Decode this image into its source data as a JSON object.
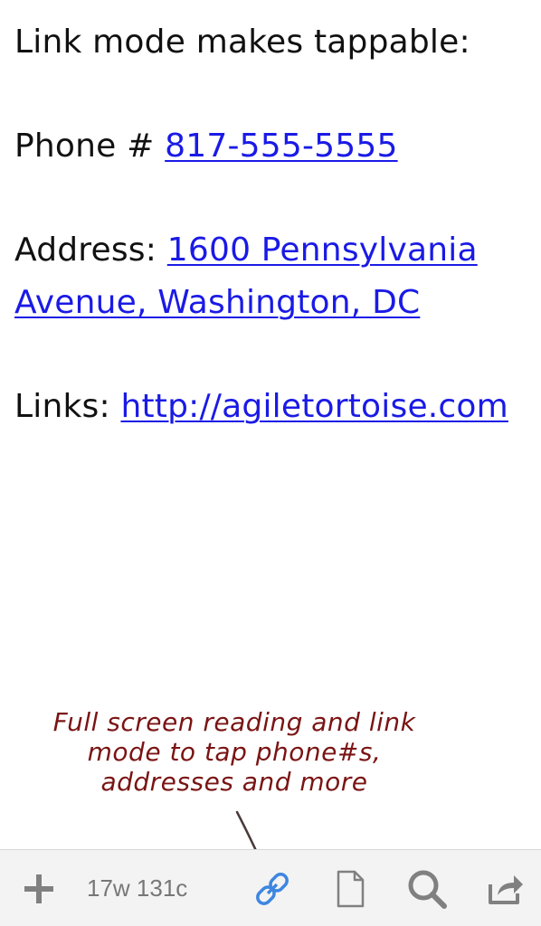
{
  "document": {
    "line1": "Link mode makes tappable:",
    "phone_label": "Phone # ",
    "phone_link": "817-555-5555",
    "address_label": "Address: ",
    "address_link_line1": "1600 Pennsylvania ",
    "address_link_line2": "Avenue, Washington, DC",
    "links_label": "Links: ",
    "links_link": "http://agiletortoise.com"
  },
  "annotation": {
    "line1": "Full screen reading and link",
    "line2": "mode to tap phone#s,",
    "line3": "addresses and more"
  },
  "toolbar": {
    "counter": "17w 131c",
    "icons": [
      "plus-icon",
      "link-icon",
      "document-icon",
      "search-icon",
      "share-icon"
    ]
  },
  "colors": {
    "link": "#1a1ae6",
    "annotation": "#7a1414",
    "toolbar_icon": "#808080",
    "active_icon": "#3d86e0"
  }
}
